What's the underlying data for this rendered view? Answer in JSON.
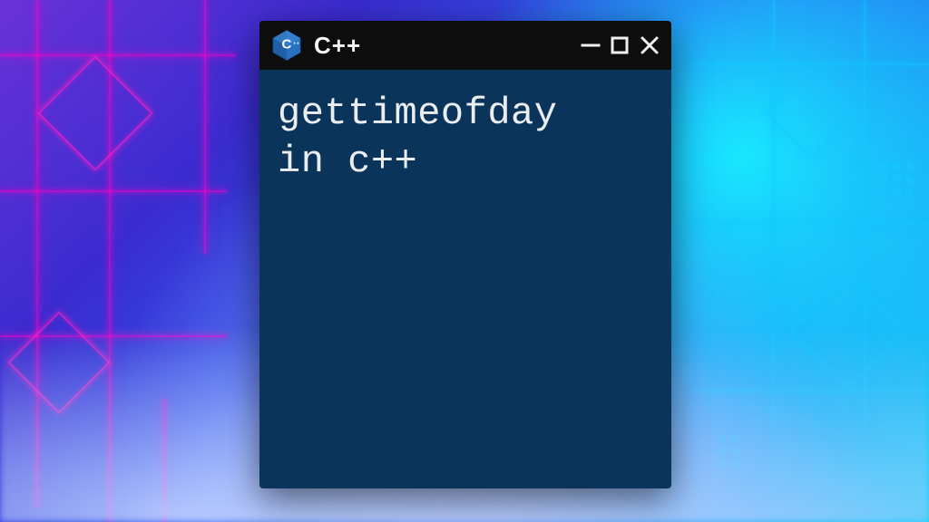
{
  "window": {
    "title": "C++",
    "icon": "cpp-icon",
    "colors": {
      "titlebar_bg": "#0d0d0d",
      "body_bg": "#0b345b",
      "text": "#ebeef0"
    }
  },
  "content": {
    "text": "gettimeofday\nin c++"
  },
  "controls": {
    "minimize": "minimize",
    "maximize": "maximize",
    "close": "close"
  }
}
